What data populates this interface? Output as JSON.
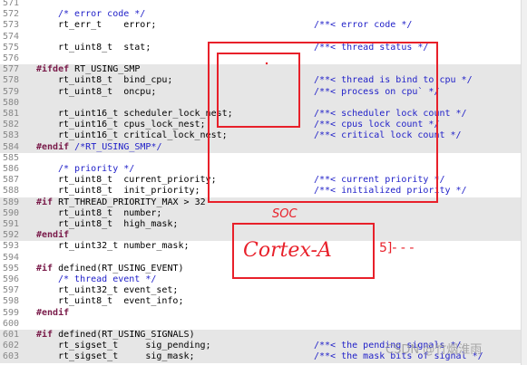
{
  "lines": [
    {
      "n": "571",
      "indent": 0,
      "parts": [],
      "comment": "",
      "hl": false
    },
    {
      "n": "572",
      "indent": 4,
      "parts": [
        {
          "t": "/* error code */",
          "c": "cmt"
        }
      ],
      "comment": "",
      "hl": false
    },
    {
      "n": "573",
      "indent": 4,
      "parts": [
        {
          "t": "rt_err_t    error;",
          "c": "plain"
        }
      ],
      "comment": "/**< error code */",
      "hl": false
    },
    {
      "n": "574",
      "indent": 0,
      "parts": [],
      "comment": "",
      "hl": false
    },
    {
      "n": "575",
      "indent": 4,
      "parts": [
        {
          "t": "rt_uint8_t  stat;",
          "c": "plain"
        }
      ],
      "comment": "/**< thread status */",
      "hl": false
    },
    {
      "n": "576",
      "indent": 0,
      "parts": [],
      "comment": "",
      "hl": false
    },
    {
      "n": "577",
      "indent": 0,
      "parts": [
        {
          "t": "#ifdef",
          "c": "dir"
        },
        {
          "t": " RT_USING_SMP",
          "c": "plain"
        }
      ],
      "comment": "",
      "hl": true
    },
    {
      "n": "578",
      "indent": 4,
      "parts": [
        {
          "t": "rt_uint8_t  bind_cpu;",
          "c": "plain"
        }
      ],
      "comment": "/**< thread is bind to cpu */",
      "hl": true
    },
    {
      "n": "579",
      "indent": 4,
      "parts": [
        {
          "t": "rt_uint8_t  oncpu;",
          "c": "plain"
        }
      ],
      "comment": "/**< process on cpu` */",
      "hl": true
    },
    {
      "n": "580",
      "indent": 0,
      "parts": [],
      "comment": "",
      "hl": true
    },
    {
      "n": "581",
      "indent": 4,
      "parts": [
        {
          "t": "rt_uint16_t scheduler_lock_nest;",
          "c": "plain"
        }
      ],
      "comment": "/**< scheduler lock count */",
      "hl": true
    },
    {
      "n": "582",
      "indent": 4,
      "parts": [
        {
          "t": "rt_uint16_t cpus_lock_nest;",
          "c": "plain"
        }
      ],
      "comment": "/**< cpus lock count */",
      "hl": true
    },
    {
      "n": "583",
      "indent": 4,
      "parts": [
        {
          "t": "rt_uint16_t critical_lock_nest;",
          "c": "plain"
        }
      ],
      "comment": "/**< critical lock count */",
      "hl": true
    },
    {
      "n": "584",
      "indent": 0,
      "parts": [
        {
          "t": "#endif",
          "c": "dir"
        },
        {
          "t": " /*RT_USING_SMP*/",
          "c": "cmt"
        }
      ],
      "comment": "",
      "hl": true
    },
    {
      "n": "585",
      "indent": 0,
      "parts": [],
      "comment": "",
      "hl": false
    },
    {
      "n": "586",
      "indent": 4,
      "parts": [
        {
          "t": "/* priority */",
          "c": "cmt"
        }
      ],
      "comment": "",
      "hl": false
    },
    {
      "n": "587",
      "indent": 4,
      "parts": [
        {
          "t": "rt_uint8_t  current_priority;",
          "c": "plain"
        }
      ],
      "comment": "/**< current priority */",
      "hl": false
    },
    {
      "n": "588",
      "indent": 4,
      "parts": [
        {
          "t": "rt_uint8_t  init_priority;",
          "c": "plain"
        }
      ],
      "comment": "/**< initialized priority */",
      "hl": false
    },
    {
      "n": "589",
      "indent": 0,
      "parts": [
        {
          "t": "#if",
          "c": "dir"
        },
        {
          "t": " RT_THREAD_PRIORITY_MAX > 32",
          "c": "plain"
        }
      ],
      "comment": "",
      "hl": true
    },
    {
      "n": "590",
      "indent": 4,
      "parts": [
        {
          "t": "rt_uint8_t  number;",
          "c": "plain"
        }
      ],
      "comment": "",
      "hl": true
    },
    {
      "n": "591",
      "indent": 4,
      "parts": [
        {
          "t": "rt_uint8_t  high_mask;",
          "c": "plain"
        }
      ],
      "comment": "",
      "hl": true
    },
    {
      "n": "592",
      "indent": 0,
      "parts": [
        {
          "t": "#endif",
          "c": "dir"
        }
      ],
      "comment": "",
      "hl": true
    },
    {
      "n": "593",
      "indent": 4,
      "parts": [
        {
          "t": "rt_uint32_t number_mask;",
          "c": "plain"
        }
      ],
      "comment": "",
      "hl": false
    },
    {
      "n": "594",
      "indent": 0,
      "parts": [],
      "comment": "",
      "hl": false
    },
    {
      "n": "595",
      "indent": 0,
      "parts": [
        {
          "t": "#if",
          "c": "dir"
        },
        {
          "t": " defined(RT_USING_EVENT)",
          "c": "plain"
        }
      ],
      "comment": "",
      "hl": false
    },
    {
      "n": "596",
      "indent": 4,
      "parts": [
        {
          "t": "/* thread event */",
          "c": "cmt"
        }
      ],
      "comment": "",
      "hl": false
    },
    {
      "n": "597",
      "indent": 4,
      "parts": [
        {
          "t": "rt_uint32_t event_set;",
          "c": "plain"
        }
      ],
      "comment": "",
      "hl": false
    },
    {
      "n": "598",
      "indent": 4,
      "parts": [
        {
          "t": "rt_uint8_t  event_info;",
          "c": "plain"
        }
      ],
      "comment": "",
      "hl": false
    },
    {
      "n": "599",
      "indent": 0,
      "parts": [
        {
          "t": "#endif",
          "c": "dir"
        }
      ],
      "comment": "",
      "hl": false
    },
    {
      "n": "600",
      "indent": 0,
      "parts": [],
      "comment": "",
      "hl": false
    },
    {
      "n": "601",
      "indent": 0,
      "parts": [
        {
          "t": "#if",
          "c": "dir"
        },
        {
          "t": " defined(RT_USING_SIGNALS)",
          "c": "plain"
        }
      ],
      "comment": "",
      "hl": true
    },
    {
      "n": "602",
      "indent": 4,
      "parts": [
        {
          "t": "rt_sigset_t     sig_pending;",
          "c": "plain"
        }
      ],
      "comment": "/**< the pending signals */",
      "hl": true
    },
    {
      "n": "603",
      "indent": 4,
      "parts": [
        {
          "t": "rt_sigset_t     sig_mask;",
          "c": "plain"
        }
      ],
      "comment": "/**< the mask bits of signal */",
      "hl": true
    }
  ],
  "annotations": {
    "soc_label": "SOC",
    "cortex_label": "Cortex-A",
    "trailing_mark": "5]- - -",
    "ink_color": "#e8202a"
  },
  "watermark": "CSDN @竹烟淮雨"
}
